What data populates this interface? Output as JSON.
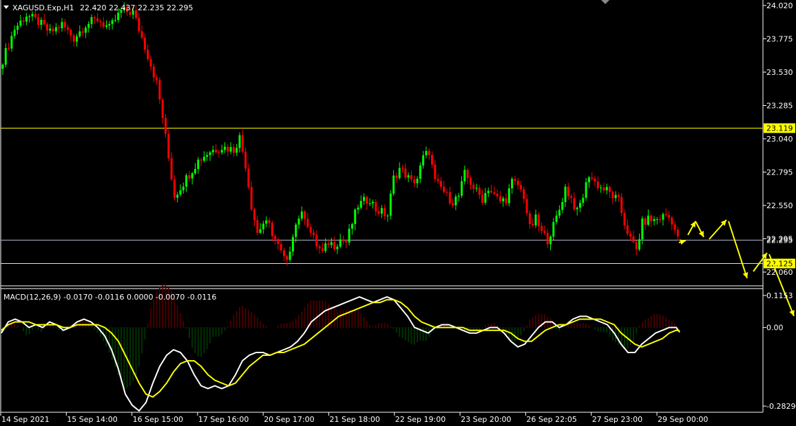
{
  "header": {
    "symbol": "XAGUSD.Exp,H1",
    "ohlc": "22.420 22.437 22.235 22.295"
  },
  "macd_header": {
    "label": "MACD(12,26,9) -0.0170 -0.0116 0.0000 -0.0070 -0.0116"
  },
  "colors": {
    "background": "#000000",
    "bull": "#00ff00",
    "bear": "#ff0000",
    "hline_yellow": "#ffff00",
    "hline_gray": "#b4b4d2",
    "macd_main": "#ffffff",
    "macd_signal": "#ffff00",
    "hist_pos": "#8b0000",
    "hist_neg": "#006400",
    "arrow": "#ffff00"
  },
  "chart_data": {
    "type": "candlestick",
    "symbol": "XAGUSD.Exp",
    "timeframe": "H1",
    "price_axis": {
      "ticks": [
        "24.020",
        "23.775",
        "23.530",
        "23.285",
        "23.040",
        "22.795",
        "22.550",
        "22.295",
        "22.060"
      ],
      "tick_values": [
        24.02,
        23.775,
        23.53,
        23.285,
        23.04,
        22.795,
        22.55,
        22.305,
        22.06
      ],
      "ymin": 21.97,
      "ymax": 24.02
    },
    "time_axis": {
      "ticks": [
        "14 Sep 2021",
        "15 Sep 14:00",
        "16 Sep 15:00",
        "17 Sep 16:00",
        "20 Sep 17:00",
        "21 Sep 18:00",
        "22 Sep 19:00",
        "23 Sep 20:00",
        "26 Sep 22:05",
        "27 Sep 23:00",
        "29 Sep 00:00"
      ]
    },
    "horizontal_levels": [
      {
        "label": "23.119",
        "value": 23.119,
        "style": "yellow"
      },
      {
        "label": "22.295",
        "value": 22.295,
        "style": "gray"
      },
      {
        "label": "22.125",
        "value": 22.125,
        "style": "yellow"
      }
    ],
    "close_path": [
      [
        0,
        23.62
      ],
      [
        4,
        23.85
      ],
      [
        8,
        23.95
      ],
      [
        12,
        23.9
      ],
      [
        16,
        23.82
      ],
      [
        20,
        23.88
      ],
      [
        24,
        23.78
      ],
      [
        28,
        23.88
      ],
      [
        32,
        23.92
      ],
      [
        36,
        23.85
      ],
      [
        40,
        23.98
      ],
      [
        44,
        23.97
      ],
      [
        48,
        23.72
      ],
      [
        52,
        23.45
      ],
      [
        54,
        23.2
      ],
      [
        56,
        22.9
      ],
      [
        58,
        22.62
      ],
      [
        62,
        22.75
      ],
      [
        66,
        22.88
      ],
      [
        70,
        22.95
      ],
      [
        74,
        22.98
      ],
      [
        78,
        22.96
      ],
      [
        80,
        23.05
      ],
      [
        82,
        22.85
      ],
      [
        84,
        22.55
      ],
      [
        86,
        22.35
      ],
      [
        88,
        22.42
      ],
      [
        90,
        22.4
      ],
      [
        92,
        22.3
      ],
      [
        94,
        22.2
      ],
      [
        96,
        22.12
      ],
      [
        98,
        22.35
      ],
      [
        100,
        22.47
      ],
      [
        102,
        22.48
      ],
      [
        104,
        22.35
      ],
      [
        106,
        22.26
      ],
      [
        108,
        22.2
      ],
      [
        110,
        22.28
      ],
      [
        112,
        22.26
      ],
      [
        114,
        22.3
      ],
      [
        116,
        22.28
      ],
      [
        118,
        22.42
      ],
      [
        120,
        22.55
      ],
      [
        122,
        22.58
      ],
      [
        124,
        22.6
      ],
      [
        126,
        22.52
      ],
      [
        128,
        22.5
      ],
      [
        130,
        22.48
      ],
      [
        132,
        22.75
      ],
      [
        134,
        22.82
      ],
      [
        136,
        22.78
      ],
      [
        138,
        22.72
      ],
      [
        140,
        22.75
      ],
      [
        142,
        22.9
      ],
      [
        144,
        22.95
      ],
      [
        146,
        22.72
      ],
      [
        148,
        22.68
      ],
      [
        150,
        22.62
      ],
      [
        152,
        22.58
      ],
      [
        154,
        22.62
      ],
      [
        156,
        22.78
      ],
      [
        158,
        22.72
      ],
      [
        160,
        22.65
      ],
      [
        162,
        22.6
      ],
      [
        164,
        22.68
      ],
      [
        166,
        22.62
      ],
      [
        168,
        22.58
      ],
      [
        170,
        22.6
      ],
      [
        172,
        22.72
      ],
      [
        174,
        22.7
      ],
      [
        176,
        22.62
      ],
      [
        178,
        22.38
      ],
      [
        180,
        22.45
      ],
      [
        182,
        22.35
      ],
      [
        184,
        22.3
      ],
      [
        186,
        22.4
      ],
      [
        188,
        22.52
      ],
      [
        190,
        22.68
      ],
      [
        192,
        22.6
      ],
      [
        194,
        22.5
      ],
      [
        196,
        22.62
      ],
      [
        198,
        22.78
      ],
      [
        200,
        22.72
      ],
      [
        202,
        22.68
      ],
      [
        204,
        22.66
      ],
      [
        206,
        22.62
      ],
      [
        208,
        22.58
      ],
      [
        210,
        22.42
      ],
      [
        212,
        22.3
      ],
      [
        214,
        22.22
      ],
      [
        216,
        22.42
      ],
      [
        218,
        22.45
      ],
      [
        220,
        22.44
      ],
      [
        222,
        22.46
      ],
      [
        224,
        22.48
      ],
      [
        226,
        22.44
      ],
      [
        228,
        22.3
      ]
    ],
    "projection_arrows": [
      [
        [
          986,
          353
        ],
        [
          996,
          350
        ]
      ],
      [
        [
          999,
          342
        ],
        [
          1010,
          322
        ]
      ],
      [
        [
          1010,
          322
        ],
        [
          1022,
          345
        ]
      ],
      [
        [
          1030,
          348
        ],
        [
          1055,
          320
        ]
      ],
      [
        [
          1058,
          322
        ],
        [
          1085,
          405
        ]
      ],
      [
        [
          1094,
          395
        ],
        [
          1114,
          368
        ]
      ],
      [
        [
          1117,
          370
        ],
        [
          1153,
          460
        ]
      ]
    ],
    "macd": {
      "label": "MACD(12,26,9)",
      "values_shown": [
        -0.017,
        -0.0116,
        0.0,
        -0.007,
        -0.0116
      ],
      "axis_ticks": [
        "0.1153",
        "0.00",
        "-0.2829"
      ],
      "axis_values": [
        0.1153,
        0.0,
        -0.2829
      ],
      "ymin": -0.32,
      "ymax": 0.17,
      "main": [
        [
          0,
          -0.02
        ],
        [
          10,
          0.02
        ],
        [
          20,
          0.03
        ],
        [
          30,
          0.02
        ],
        [
          40,
          0.0
        ],
        [
          50,
          0.01
        ],
        [
          60,
          0.0
        ],
        [
          70,
          0.02
        ],
        [
          80,
          0.01
        ],
        [
          90,
          -0.01
        ],
        [
          100,
          0.0
        ],
        [
          110,
          0.02
        ],
        [
          120,
          0.03
        ],
        [
          130,
          0.02
        ],
        [
          140,
          0.0
        ],
        [
          150,
          -0.03
        ],
        [
          160,
          -0.08
        ],
        [
          170,
          -0.15
        ],
        [
          180,
          -0.24
        ],
        [
          190,
          -0.28
        ],
        [
          200,
          -0.3
        ],
        [
          210,
          -0.27
        ],
        [
          220,
          -0.2
        ],
        [
          230,
          -0.14
        ],
        [
          240,
          -0.1
        ],
        [
          250,
          -0.08
        ],
        [
          260,
          -0.09
        ],
        [
          270,
          -0.12
        ],
        [
          280,
          -0.17
        ],
        [
          290,
          -0.21
        ],
        [
          300,
          -0.22
        ],
        [
          310,
          -0.21
        ],
        [
          320,
          -0.22
        ],
        [
          330,
          -0.21
        ],
        [
          340,
          -0.17
        ],
        [
          350,
          -0.12
        ],
        [
          360,
          -0.1
        ],
        [
          370,
          -0.09
        ],
        [
          380,
          -0.09
        ],
        [
          390,
          -0.1
        ],
        [
          400,
          -0.09
        ],
        [
          410,
          -0.08
        ],
        [
          420,
          -0.07
        ],
        [
          430,
          -0.05
        ],
        [
          440,
          -0.02
        ],
        [
          450,
          0.02
        ],
        [
          460,
          0.04
        ],
        [
          470,
          0.06
        ],
        [
          480,
          0.07
        ],
        [
          490,
          0.08
        ],
        [
          500,
          0.09
        ],
        [
          510,
          0.1
        ],
        [
          520,
          0.11
        ],
        [
          530,
          0.1
        ],
        [
          540,
          0.09
        ],
        [
          550,
          0.1
        ],
        [
          560,
          0.11
        ],
        [
          570,
          0.1
        ],
        [
          580,
          0.07
        ],
        [
          590,
          0.04
        ],
        [
          600,
          0.0
        ],
        [
          610,
          -0.01
        ],
        [
          620,
          -0.02
        ],
        [
          630,
          0.0
        ],
        [
          640,
          0.01
        ],
        [
          650,
          0.01
        ],
        [
          660,
          0.0
        ],
        [
          670,
          -0.01
        ],
        [
          680,
          -0.02
        ],
        [
          690,
          -0.02
        ],
        [
          700,
          -0.01
        ],
        [
          710,
          0.0
        ],
        [
          720,
          0.0
        ],
        [
          730,
          -0.02
        ],
        [
          740,
          -0.05
        ],
        [
          750,
          -0.07
        ],
        [
          760,
          -0.06
        ],
        [
          770,
          -0.03
        ],
        [
          780,
          0.0
        ],
        [
          790,
          0.02
        ],
        [
          800,
          0.02
        ],
        [
          810,
          0.0
        ],
        [
          820,
          0.01
        ],
        [
          830,
          0.03
        ],
        [
          840,
          0.04
        ],
        [
          850,
          0.04
        ],
        [
          860,
          0.03
        ],
        [
          870,
          0.02
        ],
        [
          880,
          0.01
        ],
        [
          890,
          -0.02
        ],
        [
          900,
          -0.06
        ],
        [
          910,
          -0.09
        ],
        [
          920,
          -0.09
        ],
        [
          930,
          -0.06
        ],
        [
          940,
          -0.04
        ],
        [
          950,
          -0.02
        ],
        [
          960,
          -0.01
        ],
        [
          970,
          0.0
        ],
        [
          980,
          0.0
        ],
        [
          985,
          -0.017
        ]
      ],
      "signal": [
        [
          0,
          -0.01
        ],
        [
          10,
          0.01
        ],
        [
          20,
          0.02
        ],
        [
          30,
          0.02
        ],
        [
          40,
          0.02
        ],
        [
          50,
          0.01
        ],
        [
          60,
          0.01
        ],
        [
          70,
          0.01
        ],
        [
          80,
          0.01
        ],
        [
          90,
          0.0
        ],
        [
          100,
          0.0
        ],
        [
          110,
          0.01
        ],
        [
          120,
          0.01
        ],
        [
          130,
          0.01
        ],
        [
          140,
          0.01
        ],
        [
          150,
          0.0
        ],
        [
          160,
          -0.02
        ],
        [
          170,
          -0.05
        ],
        [
          180,
          -0.1
        ],
        [
          190,
          -0.15
        ],
        [
          200,
          -0.2
        ],
        [
          210,
          -0.24
        ],
        [
          220,
          -0.25
        ],
        [
          230,
          -0.23
        ],
        [
          240,
          -0.2
        ],
        [
          250,
          -0.16
        ],
        [
          260,
          -0.13
        ],
        [
          270,
          -0.12
        ],
        [
          280,
          -0.12
        ],
        [
          290,
          -0.14
        ],
        [
          300,
          -0.17
        ],
        [
          310,
          -0.19
        ],
        [
          320,
          -0.2
        ],
        [
          330,
          -0.21
        ],
        [
          340,
          -0.2
        ],
        [
          350,
          -0.17
        ],
        [
          360,
          -0.14
        ],
        [
          370,
          -0.12
        ],
        [
          380,
          -0.1
        ],
        [
          390,
          -0.1
        ],
        [
          400,
          -0.09
        ],
        [
          410,
          -0.09
        ],
        [
          420,
          -0.08
        ],
        [
          430,
          -0.07
        ],
        [
          440,
          -0.06
        ],
        [
          450,
          -0.04
        ],
        [
          460,
          -0.02
        ],
        [
          470,
          0.0
        ],
        [
          480,
          0.02
        ],
        [
          490,
          0.04
        ],
        [
          500,
          0.05
        ],
        [
          510,
          0.06
        ],
        [
          520,
          0.07
        ],
        [
          530,
          0.08
        ],
        [
          540,
          0.09
        ],
        [
          550,
          0.09
        ],
        [
          560,
          0.1
        ],
        [
          570,
          0.1
        ],
        [
          580,
          0.09
        ],
        [
          590,
          0.07
        ],
        [
          600,
          0.04
        ],
        [
          610,
          0.02
        ],
        [
          620,
          0.01
        ],
        [
          630,
          0.0
        ],
        [
          640,
          0.0
        ],
        [
          650,
          0.0
        ],
        [
          660,
          0.0
        ],
        [
          670,
          0.0
        ],
        [
          680,
          -0.01
        ],
        [
          690,
          -0.01
        ],
        [
          700,
          -0.01
        ],
        [
          710,
          -0.01
        ],
        [
          720,
          -0.01
        ],
        [
          730,
          -0.01
        ],
        [
          740,
          -0.02
        ],
        [
          750,
          -0.04
        ],
        [
          760,
          -0.05
        ],
        [
          770,
          -0.05
        ],
        [
          780,
          -0.03
        ],
        [
          790,
          -0.01
        ],
        [
          800,
          0.0
        ],
        [
          810,
          0.01
        ],
        [
          820,
          0.01
        ],
        [
          830,
          0.02
        ],
        [
          840,
          0.03
        ],
        [
          850,
          0.03
        ],
        [
          860,
          0.03
        ],
        [
          870,
          0.03
        ],
        [
          880,
          0.02
        ],
        [
          890,
          0.01
        ],
        [
          900,
          -0.02
        ],
        [
          910,
          -0.04
        ],
        [
          920,
          -0.06
        ],
        [
          930,
          -0.07
        ],
        [
          940,
          -0.06
        ],
        [
          950,
          -0.05
        ],
        [
          960,
          -0.04
        ],
        [
          970,
          -0.02
        ],
        [
          980,
          -0.01
        ],
        [
          985,
          -0.0116
        ]
      ]
    }
  }
}
